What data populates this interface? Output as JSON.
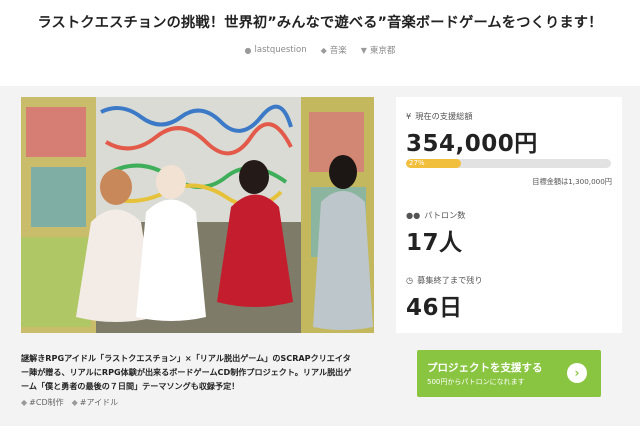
{
  "project": {
    "title": "ラストクエスチョンの挑戦！世界初”みんなで遊べる”音楽ボードゲームをつくります！",
    "owner": "lastquestion",
    "category": "音楽",
    "location": "東京都"
  },
  "description": {
    "line1": "謎解きRPGアイドル「ラストクエスチョン」×「リアル脱出ゲーム」のSCRAPクリエイタ",
    "line2": "ー陣が贈る、リアルにRPG体験が出来るボードゲームCD制作プロジェクト。リアル脱出ゲ",
    "line3": "ーム「僕と勇者の最後の７日間」テーマソングも収録予定！"
  },
  "tags": [
    "#CD制作",
    "#アイドル"
  ],
  "stats": {
    "raised_label": "現在の支援総額",
    "raised_value": "354,000円",
    "progress_percent": 27,
    "progress_label": "27%",
    "goal_text": "目標金額は1,300,000円",
    "backers_label": "パトロン数",
    "backers_value": "17人",
    "days_label": "募集終了まで残り",
    "days_value": "46日"
  },
  "cta": {
    "label": "プロジェクトを支援する",
    "sublabel": "500円からパトロンになれます"
  },
  "icons": [
    "user-icon",
    "tag-icon",
    "location-icon",
    "yen-icon",
    "people-icon",
    "clock-icon",
    "arrow-right-icon"
  ],
  "colors": {
    "accent_green": "#8ac542",
    "progress_yellow": "#f2bf3d"
  }
}
